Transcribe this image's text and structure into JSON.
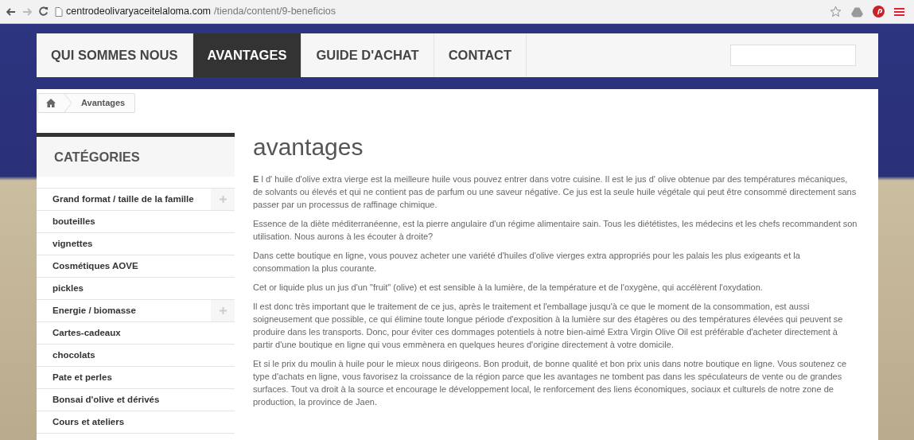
{
  "browser": {
    "url_host": "centrodeolivaryaceitelaloma.com",
    "url_path": "/tienda/content/9-beneficios"
  },
  "nav": {
    "items": [
      {
        "label": "QUI SOMMES NOUS",
        "selected": false
      },
      {
        "label": "AVANTAGES",
        "selected": true
      },
      {
        "label": "GUIDE D'ACHAT",
        "selected": false
      },
      {
        "label": "CONTACT",
        "selected": false
      }
    ]
  },
  "breadcrumb": {
    "items": [
      "Avantages"
    ]
  },
  "sidebar": {
    "title": "CATÉGORIES",
    "items": [
      {
        "label": "Grand format / taille de la famille",
        "expandable": true
      },
      {
        "label": "bouteilles",
        "expandable": false
      },
      {
        "label": "vignettes",
        "expandable": false
      },
      {
        "label": "Cosmétiques AOVE",
        "expandable": false
      },
      {
        "label": "pickles",
        "expandable": false
      },
      {
        "label": "Energie / biomasse",
        "expandable": true
      },
      {
        "label": "Cartes-cadeaux",
        "expandable": false
      },
      {
        "label": "chocolats",
        "expandable": false
      },
      {
        "label": "Pate et perles",
        "expandable": false
      },
      {
        "label": "Bonsai d'olive et dérivés",
        "expandable": false
      },
      {
        "label": "Cours et ateliers",
        "expandable": false
      }
    ]
  },
  "content": {
    "title": "avantages",
    "paragraphs": [
      "**E** l d' huile d'olive extra vierge est la meilleure huile vous pouvez entrer dans votre cuisine. Il est le jus d' olive obtenue par des températures mécaniques, de solvants ou élevés et qui ne contient pas de parfum ou une saveur négative. Ce jus est la seule huile végétale qui peut être consommé directement sans passer par un processus de raffinage chimique.",
      "Essence de la diète méditerranéenne, est la pierre angulaire d'un régime alimentaire sain. Tous les diététistes, les médecins et les chefs recommandent son utilisation. Nous aurons à les écouter à droite?",
      "Dans cette boutique en ligne, vous pouvez acheter une variété d'huiles d'olive vierges extra appropriés pour les palais les plus exigeants et la consommation la plus courante.",
      "Cet or liquide plus un jus d'un \"fruit\" (olive) et est sensible à la lumière, de la température et de l'oxygène, qui accélèrent l'oxydation.",
      "Il est donc très important que le traitement de ce jus, après le traitement et l'emballage jusqu'à ce que le moment de la consommation, est aussi soigneusement que possible, ce qui élimine toute longue période d'exposition à la lumière sur des étagères ou des températures élevées qui peuvent se produire dans les transports. Donc, pour éviter ces dommages potentiels à notre bien-aimé Extra Virgin Olive Oil est préférable d'acheter directement à partir d'une boutique en ligne qui vous emmènera en quelques heures d'origine directement à votre domicile.",
      "Et si le prix du moulin à huile pour le mieux nous dirigeons. Bon produit, de bonne qualité et bon prix unis dans notre boutique en ligne. Vous soutenez ce type d'achats en ligne, vous favorisez la croissance de la région parce que les avantages ne tombent pas dans les spéculateurs de vente ou de grandes surfaces. Tout va droit à la source et encourage le développement local, le renforcement des liens économiques, sociaux et culturels de notre zone de production, la province de Jaen."
    ]
  }
}
